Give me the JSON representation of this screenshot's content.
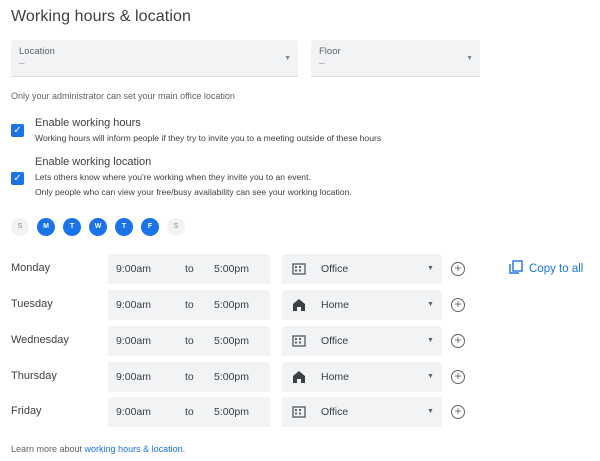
{
  "title": "Working hours & location",
  "location_select": {
    "label": "Location",
    "value": "–"
  },
  "floor_select": {
    "label": "Floor",
    "value": "–"
  },
  "admin_note": "Only your administrator can set your main office location",
  "enable_hours": {
    "checked": true,
    "title": "Enable working hours",
    "desc": "Working hours will inform people if they try to invite you to a meeting outside of these hours"
  },
  "enable_location": {
    "checked": true,
    "title": "Enable working location",
    "desc1": "Lets others know where you're working when they invite you to an event.",
    "desc2": "Only people who can view your free/busy availability can see your working location."
  },
  "days": [
    {
      "label": "S",
      "selected": false
    },
    {
      "label": "M",
      "selected": true
    },
    {
      "label": "T",
      "selected": true
    },
    {
      "label": "W",
      "selected": true
    },
    {
      "label": "T",
      "selected": true
    },
    {
      "label": "F",
      "selected": true
    },
    {
      "label": "S",
      "selected": false
    }
  ],
  "schedule": [
    {
      "day": "Monday",
      "start": "9:00am",
      "to": "to",
      "end": "5:00pm",
      "location": "Office",
      "icon": "office-icon"
    },
    {
      "day": "Tuesday",
      "start": "9:00am",
      "to": "to",
      "end": "5:00pm",
      "location": "Home",
      "icon": "home-icon"
    },
    {
      "day": "Wednesday",
      "start": "9:00am",
      "to": "to",
      "end": "5:00pm",
      "location": "Office",
      "icon": "office-icon"
    },
    {
      "day": "Thursday",
      "start": "9:00am",
      "to": "to",
      "end": "5:00pm",
      "location": "Home",
      "icon": "home-icon"
    },
    {
      "day": "Friday",
      "start": "9:00am",
      "to": "to",
      "end": "5:00pm",
      "location": "Office",
      "icon": "office-icon"
    }
  ],
  "copy_all": "Copy to all",
  "footer": {
    "prefix": "Learn more about ",
    "link": "working hours & location",
    "suffix": "."
  },
  "colors": {
    "accent": "#1a73e8",
    "field_bg": "#f1f3f4",
    "text": "#3c4043"
  }
}
